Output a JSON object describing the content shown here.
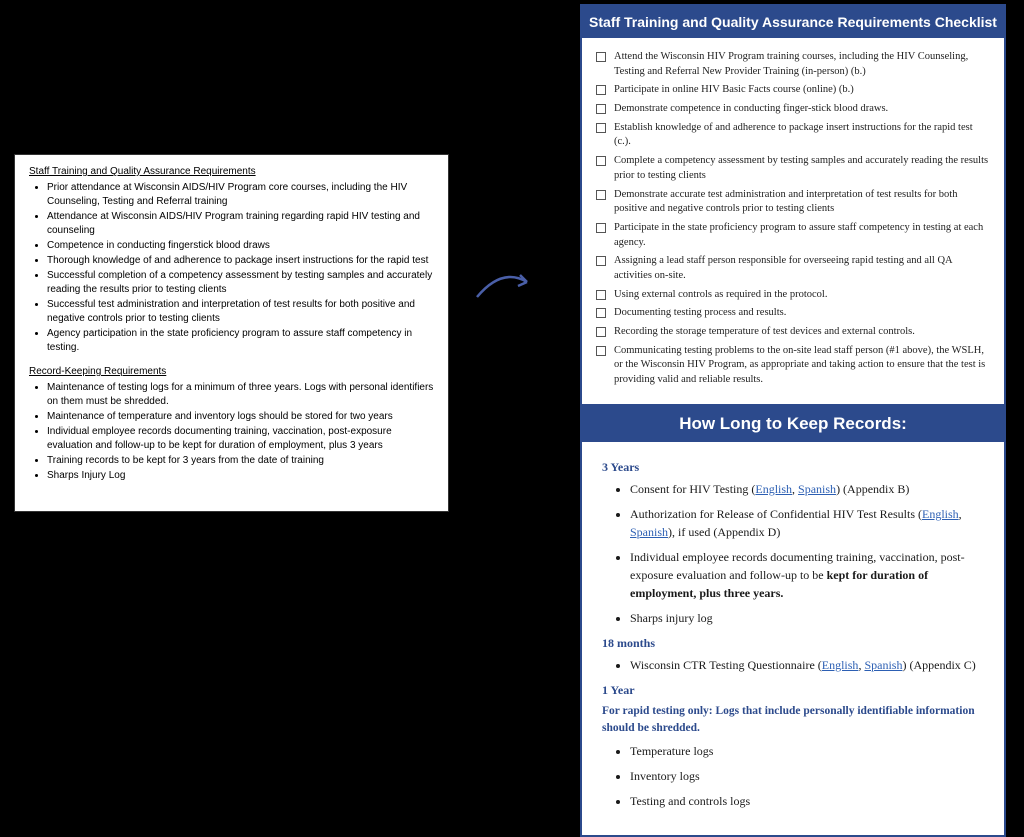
{
  "left": {
    "heading1": "Staff Training and Quality Assurance Requirements",
    "items1": [
      "Prior attendance at Wisconsin AIDS/HIV Program core courses, including the HIV Counseling, Testing and Referral training",
      "Attendance at Wisconsin AIDS/HIV Program training regarding rapid HIV testing and counseling",
      "Competence in conducting fingerstick blood draws",
      "Thorough knowledge of and adherence to package insert instructions for the rapid test",
      "Successful completion of a competency assessment by testing samples and accurately reading the results prior to testing clients",
      "Successful test administration and interpretation of test results for both positive and negative controls prior to testing clients",
      "Agency participation in the state proficiency program to assure staff competency in testing."
    ],
    "heading2": "Record-Keeping Requirements",
    "items2": [
      "Maintenance of testing logs for a minimum of three years. Logs with personal identifiers on them must be shredded.",
      "Maintenance of temperature and inventory logs should be stored for two years",
      "Individual employee records documenting training, vaccination, post-exposure evaluation and follow-up to be kept for duration of employment, plus 3 years",
      "Training records to be kept for 3 years from the date of training",
      "Sharps Injury Log"
    ]
  },
  "checklist": {
    "title": "Staff Training and Quality Assurance Requirements Checklist",
    "items": [
      "Attend the Wisconsin HIV Program training courses, including the HIV Counseling, Testing and Referral New Provider Training (in-person) (b.)",
      "Participate in online HIV Basic Facts course (online) (b.)",
      "Demonstrate competence in conducting finger-stick blood draws.",
      "Establish knowledge of and adherence to package insert instructions for the rapid test (c.).",
      "Complete a competency assessment by testing samples and accurately reading the results prior to testing clients",
      "Demonstrate accurate test administration and interpretation of test results for both positive and negative controls prior to testing clients",
      "Participate in the state proficiency program to assure staff competency in testing at each agency.",
      "Assigning a lead staff person responsible for overseeing rapid testing and all QA activities on-site.",
      "Using external controls as required in the protocol.",
      "Documenting testing process and results.",
      "Recording the storage temperature of test devices and external controls.",
      "Communicating testing problems to the on-site lead staff person (#1 above), the WSLH, or the Wisconsin HIV Program, as appropriate and taking action to ensure that the test is providing valid and reliable results."
    ]
  },
  "records": {
    "title": "How Long to Keep Records:",
    "y3_head": "3 Years",
    "y3_i1_a": "Consent for HIV Testing (",
    "y3_i1_en": "English",
    "y3_sep": ", ",
    "y3_i1_es": "Spanish",
    "y3_i1_b": ") (Appendix B)",
    "y3_i2_a": "Authorization for Release of Confidential HIV Test Results (",
    "y3_i2_b": "), if used (Appendix D)",
    "y3_i3_a": "Individual employee records documenting training, vaccination, post-exposure evaluation and follow-up to be ",
    "y3_i3_bold": "kept for duration of employment, plus three years.",
    "y3_i4": "Sharps injury log",
    "m18_head": "18 months",
    "m18_i1_a": "Wisconsin CTR Testing Questionnaire (",
    "m18_i1_b": ") (Appendix C)",
    "y1_head": "1 Year",
    "y1_note": "For rapid testing only: Logs that include personally identifiable information should be shredded.",
    "y1_items": [
      "Temperature logs",
      "Inventory logs",
      "Testing and controls logs"
    ],
    "link_en": "English",
    "link_es": "Spanish"
  }
}
